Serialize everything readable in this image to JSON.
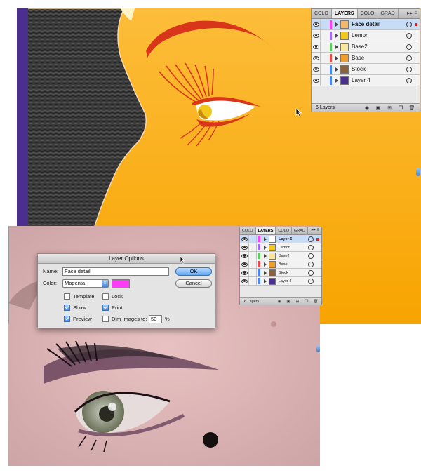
{
  "colors": {
    "face_bg": "#fbb72f",
    "purple_strip": "#4a2f8f",
    "magenta_swatch": "#ff3df7",
    "selected_row": "#c7dcf7"
  },
  "top_panel": {
    "tabs": [
      "COLO",
      "LAYERS",
      "COLO",
      "GRAD"
    ],
    "active_tab": 1,
    "controls": "▸▸  ≡",
    "layers": [
      {
        "name": "Face detail",
        "color": "#ff40ff",
        "selected": true,
        "thumb": "#f3b86b"
      },
      {
        "name": "Lemon",
        "color": "#a26bff",
        "selected": false,
        "thumb": "#f2c81d"
      },
      {
        "name": "Base2",
        "color": "#5ecc5e",
        "selected": false,
        "thumb": "#fbe6a0"
      },
      {
        "name": "Base",
        "color": "#ef4a4a",
        "selected": false,
        "thumb": "#f09e2c"
      },
      {
        "name": "Stock",
        "color": "#4a86ff",
        "selected": false,
        "thumb": "#8b6240"
      },
      {
        "name": "Layer 4",
        "color": "#4a86ff",
        "selected": false,
        "thumb": "#4a2f8f"
      }
    ],
    "count": "6 Layers"
  },
  "bottom_panel": {
    "tabs": [
      "COLO",
      "LAYERS",
      "COLO",
      "GRAD"
    ],
    "active_tab": 1,
    "controls": "▸▸ ≡",
    "layers": [
      {
        "name": "Layer 6",
        "color": "#ff40ff",
        "selected": true,
        "thumb": "#ffffff"
      },
      {
        "name": "Lemon",
        "color": "#a26bff",
        "selected": false,
        "thumb": "#f2c81d"
      },
      {
        "name": "Base2",
        "color": "#5ecc5e",
        "selected": false,
        "thumb": "#fbe6a0"
      },
      {
        "name": "Base",
        "color": "#ef4a4a",
        "selected": false,
        "thumb": "#f09e2c"
      },
      {
        "name": "Stock",
        "color": "#4a86ff",
        "selected": false,
        "thumb": "#8b6240"
      },
      {
        "name": "Layer 4",
        "color": "#4a86ff",
        "selected": false,
        "thumb": "#4a2f8f"
      }
    ],
    "count": "6 Layers"
  },
  "dialog": {
    "title": "Layer Options",
    "name_label": "Name:",
    "name_value": "Face detail",
    "color_label": "Color:",
    "color_value": "Magenta",
    "ok_label": "OK",
    "cancel_label": "Cancel",
    "template_label": "Template",
    "lock_label": "Lock",
    "show_label": "Show",
    "print_label": "Print",
    "preview_label": "Preview",
    "dim_label": "Dim Images to:",
    "dim_value": "50",
    "percent": "%",
    "checks": {
      "template": false,
      "lock": false,
      "show": true,
      "print": true,
      "preview": true,
      "dim": false
    }
  }
}
